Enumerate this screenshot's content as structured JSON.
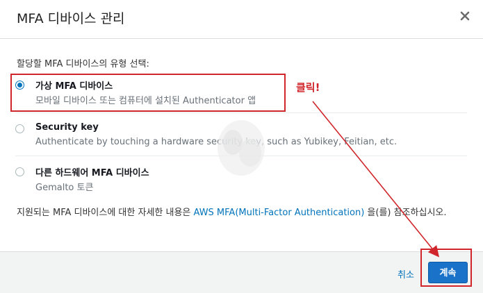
{
  "dialog": {
    "title": "MFA 디바이스 관리",
    "close_icon": "close-icon",
    "prompt": "할당할 MFA 디바이스의 유형 선택:",
    "options": [
      {
        "label": "가상 MFA 디바이스",
        "description": "모바일 디바이스 또는 컴퓨터에 설치된 Authenticator 앱",
        "selected": true
      },
      {
        "label": "Security key",
        "description": "Authenticate by touching a hardware security key, such as Yubikey, Feitian, etc.",
        "selected": false
      },
      {
        "label": "다른 하드웨어 MFA 디바이스",
        "description": "Gemalto 토큰",
        "selected": false
      }
    ],
    "info": {
      "prefix": "지원되는 MFA 디바이스에 대한 자세한 내용은 ",
      "link": "AWS MFA(Multi-Factor Authentication)",
      "suffix": " 을(를) 참조하십시오."
    },
    "footer": {
      "cancel_label": "취소",
      "continue_label": "계속"
    }
  },
  "annotation": {
    "text": "클릭!",
    "color": "#d0262b"
  },
  "colors": {
    "accent": "#0073bb",
    "primary_button": "#1a73c9",
    "annotation_red": "#d0262b"
  }
}
